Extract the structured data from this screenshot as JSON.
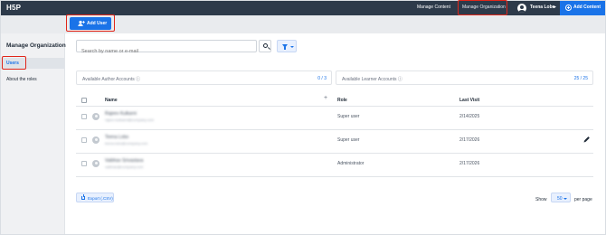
{
  "topbar": {
    "logo": "H5P",
    "nav": {
      "manage_content": "Manage Content",
      "manage_organization": "Manage Organization"
    },
    "user_name": "Teena Lobo",
    "add_content": "Add Content",
    "colors": {
      "bar": "#2d3a4a",
      "accent": "#1a73e8"
    }
  },
  "toolbar": {
    "add_user_label": "Add User"
  },
  "sidebar": {
    "title": "Manage Organization",
    "items": [
      {
        "label": "Users",
        "active": true
      },
      {
        "label": "About the roles",
        "active": false
      }
    ]
  },
  "search": {
    "placeholder": "Search by name or e-mail"
  },
  "accounts": {
    "author": {
      "label": "Available Author Accounts ⓘ",
      "value": "0 / 3"
    },
    "learner": {
      "label": "Available Learner Accounts ⓘ",
      "value": "25 / 25"
    }
  },
  "table": {
    "headers": {
      "name": "Name",
      "plus": "+",
      "role": "Role",
      "last_visit": "Last Visit"
    },
    "rows": [
      {
        "name": "Rajeev Kulkarni",
        "email": "rajeev.kulkarni@company.com",
        "role": "Super user",
        "last_visit": "2/14/2025",
        "editable": false
      },
      {
        "name": "Teena Lobo",
        "email": "teena.lobo@company.com",
        "role": "Super user",
        "last_visit": "2/17/2026",
        "editable": true
      },
      {
        "name": "Vaibhav Srivastava",
        "email": "vaibhav@company.com",
        "role": "Administrator",
        "last_visit": "2/17/2026",
        "editable": false
      }
    ]
  },
  "footer": {
    "export_label": "Export (.CSV)",
    "show_label": "Show",
    "page_size": "50",
    "per_page_label": "per page"
  }
}
